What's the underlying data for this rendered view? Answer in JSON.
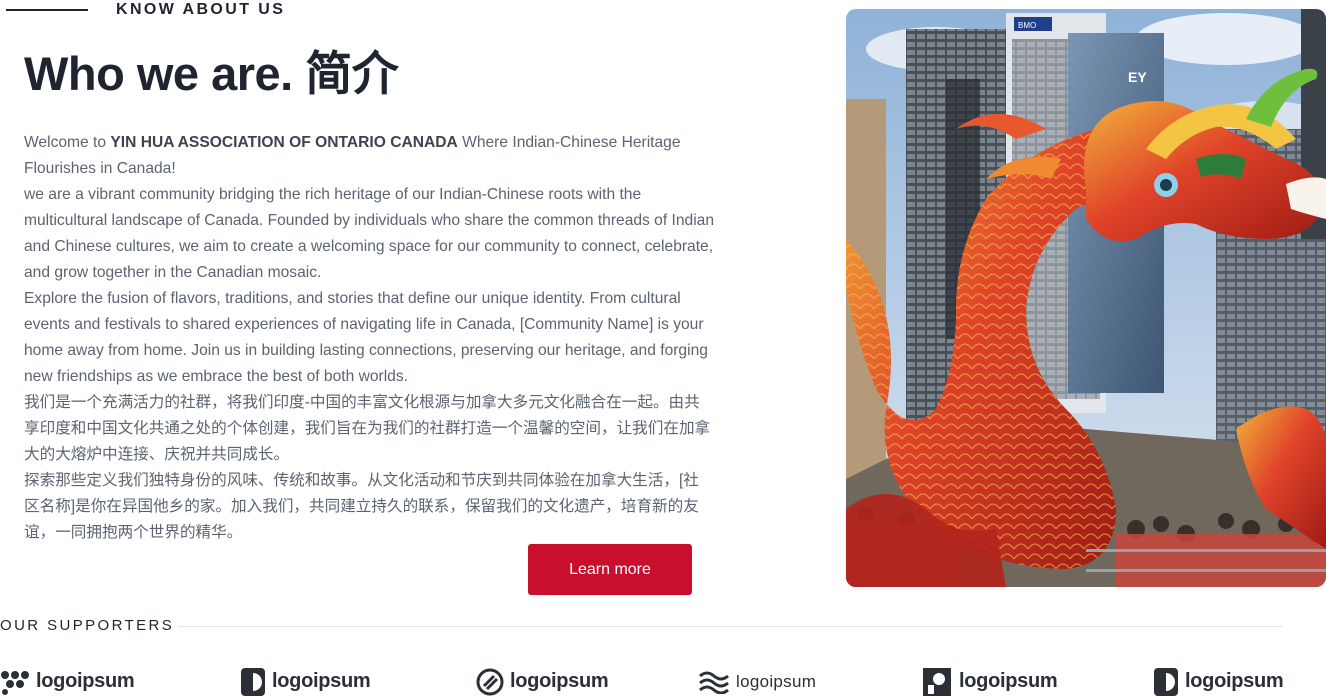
{
  "section": {
    "eyebrow": "KNOW ABOUT US",
    "title": "Who we are. 简介"
  },
  "about": {
    "intro_prefix": "Welcome to ",
    "org_name": "YIN HUA ASSOCIATION OF ONTARIO CANADA",
    "intro_suffix": " Where Indian-Chinese Heritage Flourishes in Canada!",
    "p1": "we are a vibrant community bridging the rich heritage of our Indian-Chinese roots with the multicultural landscape of Canada. Founded by individuals who share the common threads of Indian and Chinese cultures, we aim to create a welcoming space for our community to connect, celebrate, and grow together in the Canadian mosaic.",
    "p2": "Explore the fusion of flavors, traditions, and stories that define our unique identity. From cultural events and festivals to shared experiences of navigating life in Canada, [Community Name] is your home away from home. Join us in building lasting connections, preserving our heritage, and forging new friendships as we embrace the best of both worlds.",
    "p3": "我们是一个充满活力的社群，将我们印度-中国的丰富文化根源与加拿大多元文化融合在一起。由共享印度和中国文化共通之处的个体创建，我们旨在为我们的社群打造一个温馨的空间，让我们在加拿大的大熔炉中连接、庆祝并共同成长。",
    "p4": "探索那些定义我们独特身份的风味、传统和故事。从文化活动和节庆到共同体验在加拿大生活，[社区名称]是你在异国他乡的家。加入我们，共同建立持久的联系，保留我们的文化遗产，培育新的友谊，一同拥抱两个世界的精华。",
    "cta_label": "Learn more"
  },
  "hero_image": {
    "building_signs": [
      "BMO",
      "EY"
    ]
  },
  "supporters": {
    "label": "OUR SUPPORTERS",
    "logos": [
      "logoipsum",
      "logoipsum",
      "logoipsum",
      "logoipsum",
      "logoipsum",
      "logoipsum"
    ]
  },
  "colors": {
    "accent": "#c8102e",
    "heading": "#1f2431",
    "body": "#5b6470"
  }
}
